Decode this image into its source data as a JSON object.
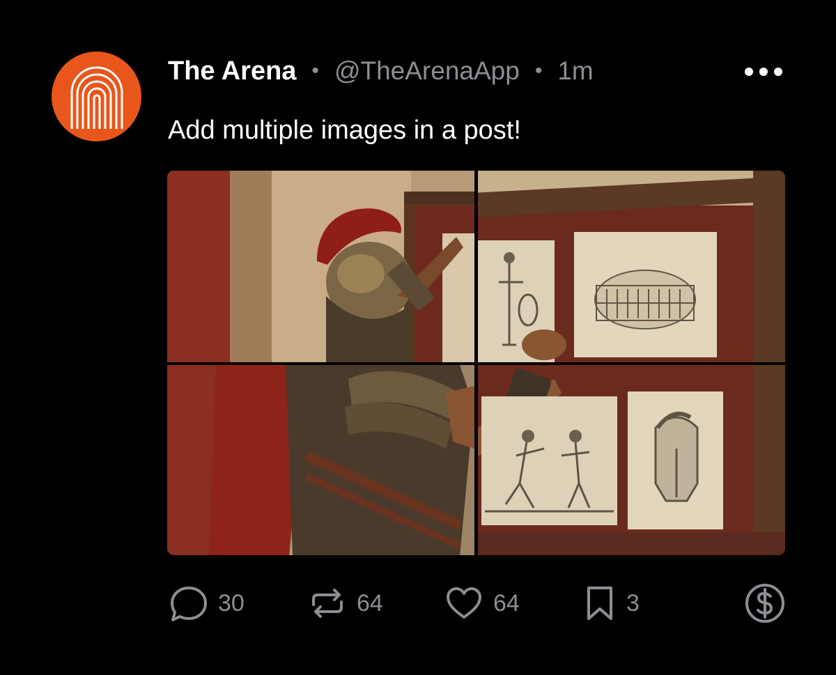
{
  "post": {
    "author_name": "The Arena",
    "separator": "•",
    "handle": "@TheArenaApp",
    "time": "1m",
    "text": "Add multiple images in a post!"
  },
  "actions": {
    "replies": "30",
    "reposts": "64",
    "likes": "64",
    "bookmarks": "3"
  },
  "icons": {
    "avatar": "arena-logo-icon",
    "more": "more-dots-icon",
    "reply": "reply-icon",
    "repost": "repost-icon",
    "like": "heart-icon",
    "bookmark": "bookmark-icon",
    "tip": "dollar-icon"
  },
  "colors": {
    "background": "#000000",
    "brand_orange": "#e8561b",
    "muted_text": "#8b8f94",
    "primary_text": "#ffffff"
  }
}
